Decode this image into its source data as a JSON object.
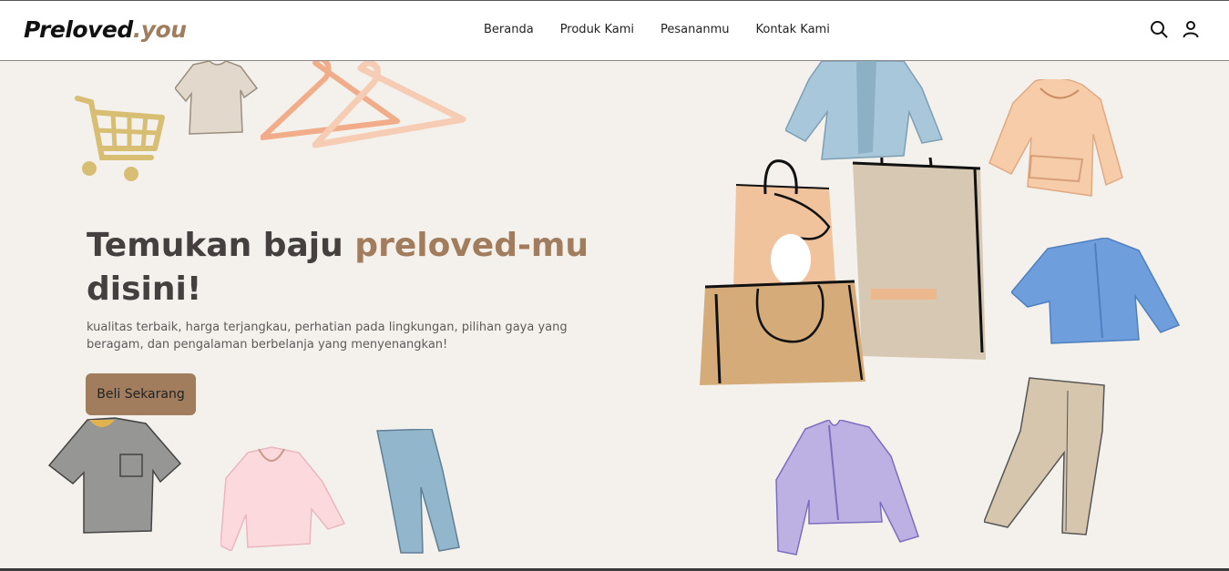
{
  "brand": {
    "name": "Preloved",
    "suffix": ".you"
  },
  "nav": {
    "items": [
      {
        "label": "Beranda"
      },
      {
        "label": "Produk Kami"
      },
      {
        "label": "Pesananmu"
      },
      {
        "label": "Kontak Kami"
      }
    ],
    "icons": [
      "search-icon",
      "user-icon"
    ]
  },
  "hero": {
    "headline_part1": "Temukan baju ",
    "headline_accent": "preloved-mu",
    "headline_part2": "disini!",
    "tagline": "kualitas terbaik, harga terjangkau, perhatian pada lingkungan, pilihan gaya yang beragam, dan pengalaman berbelanja yang menyenangkan!",
    "cta_label": "Beli Sekarang"
  },
  "colors": {
    "accent": "#a17d5e",
    "headline": "#45403f",
    "background": "#f4f1ed",
    "navbar": "#ffffff"
  },
  "illustrations": [
    "shopping-cart",
    "beige-tshirt",
    "clothes-hangers",
    "blue-jacket",
    "peach-hoodie",
    "shopping-bags",
    "blue-shirt",
    "grey-tshirt",
    "pink-blouse",
    "blue-jeans",
    "purple-cardigan",
    "beige-trousers"
  ]
}
